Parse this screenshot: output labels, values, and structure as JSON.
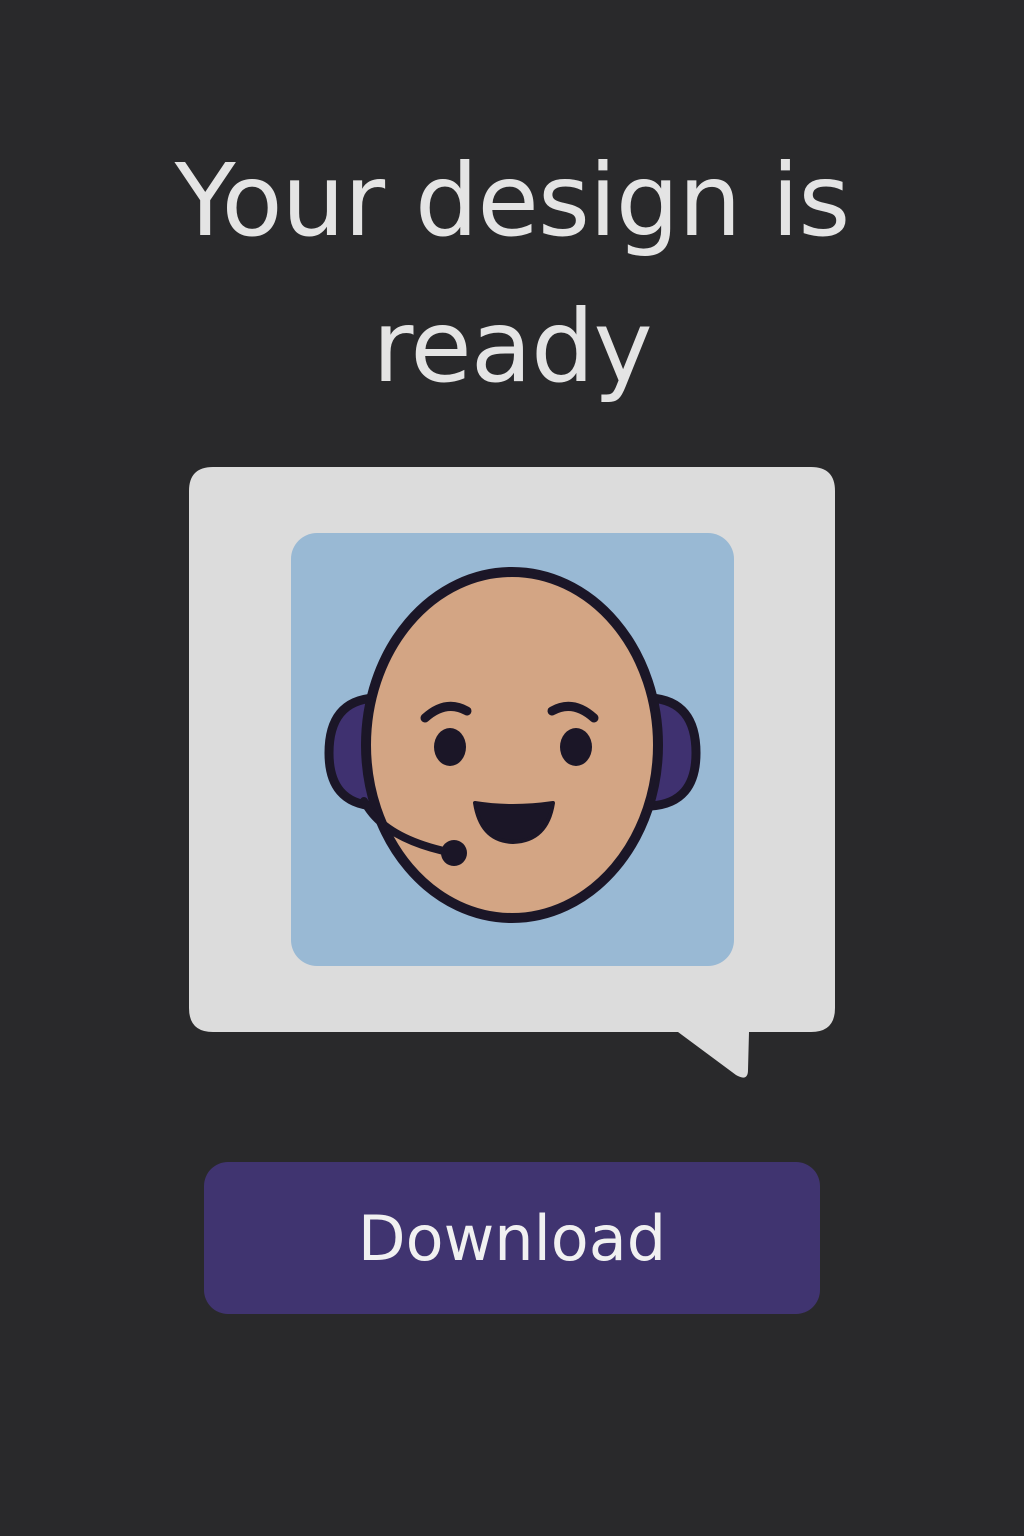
{
  "title": "Your design is ready",
  "download_button": {
    "label": "Download"
  },
  "preview": {
    "icon": "support-agent-avatar-icon"
  },
  "colors": {
    "background": "#29292b",
    "bubble": "#dcdcdc",
    "card": "#99b9d4",
    "skin": "#d3a584",
    "headset": "#3f3170",
    "outline": "#1b1627",
    "button": "#403470",
    "title_text": "#e4e4e4",
    "button_text": "#f1f1f1"
  }
}
